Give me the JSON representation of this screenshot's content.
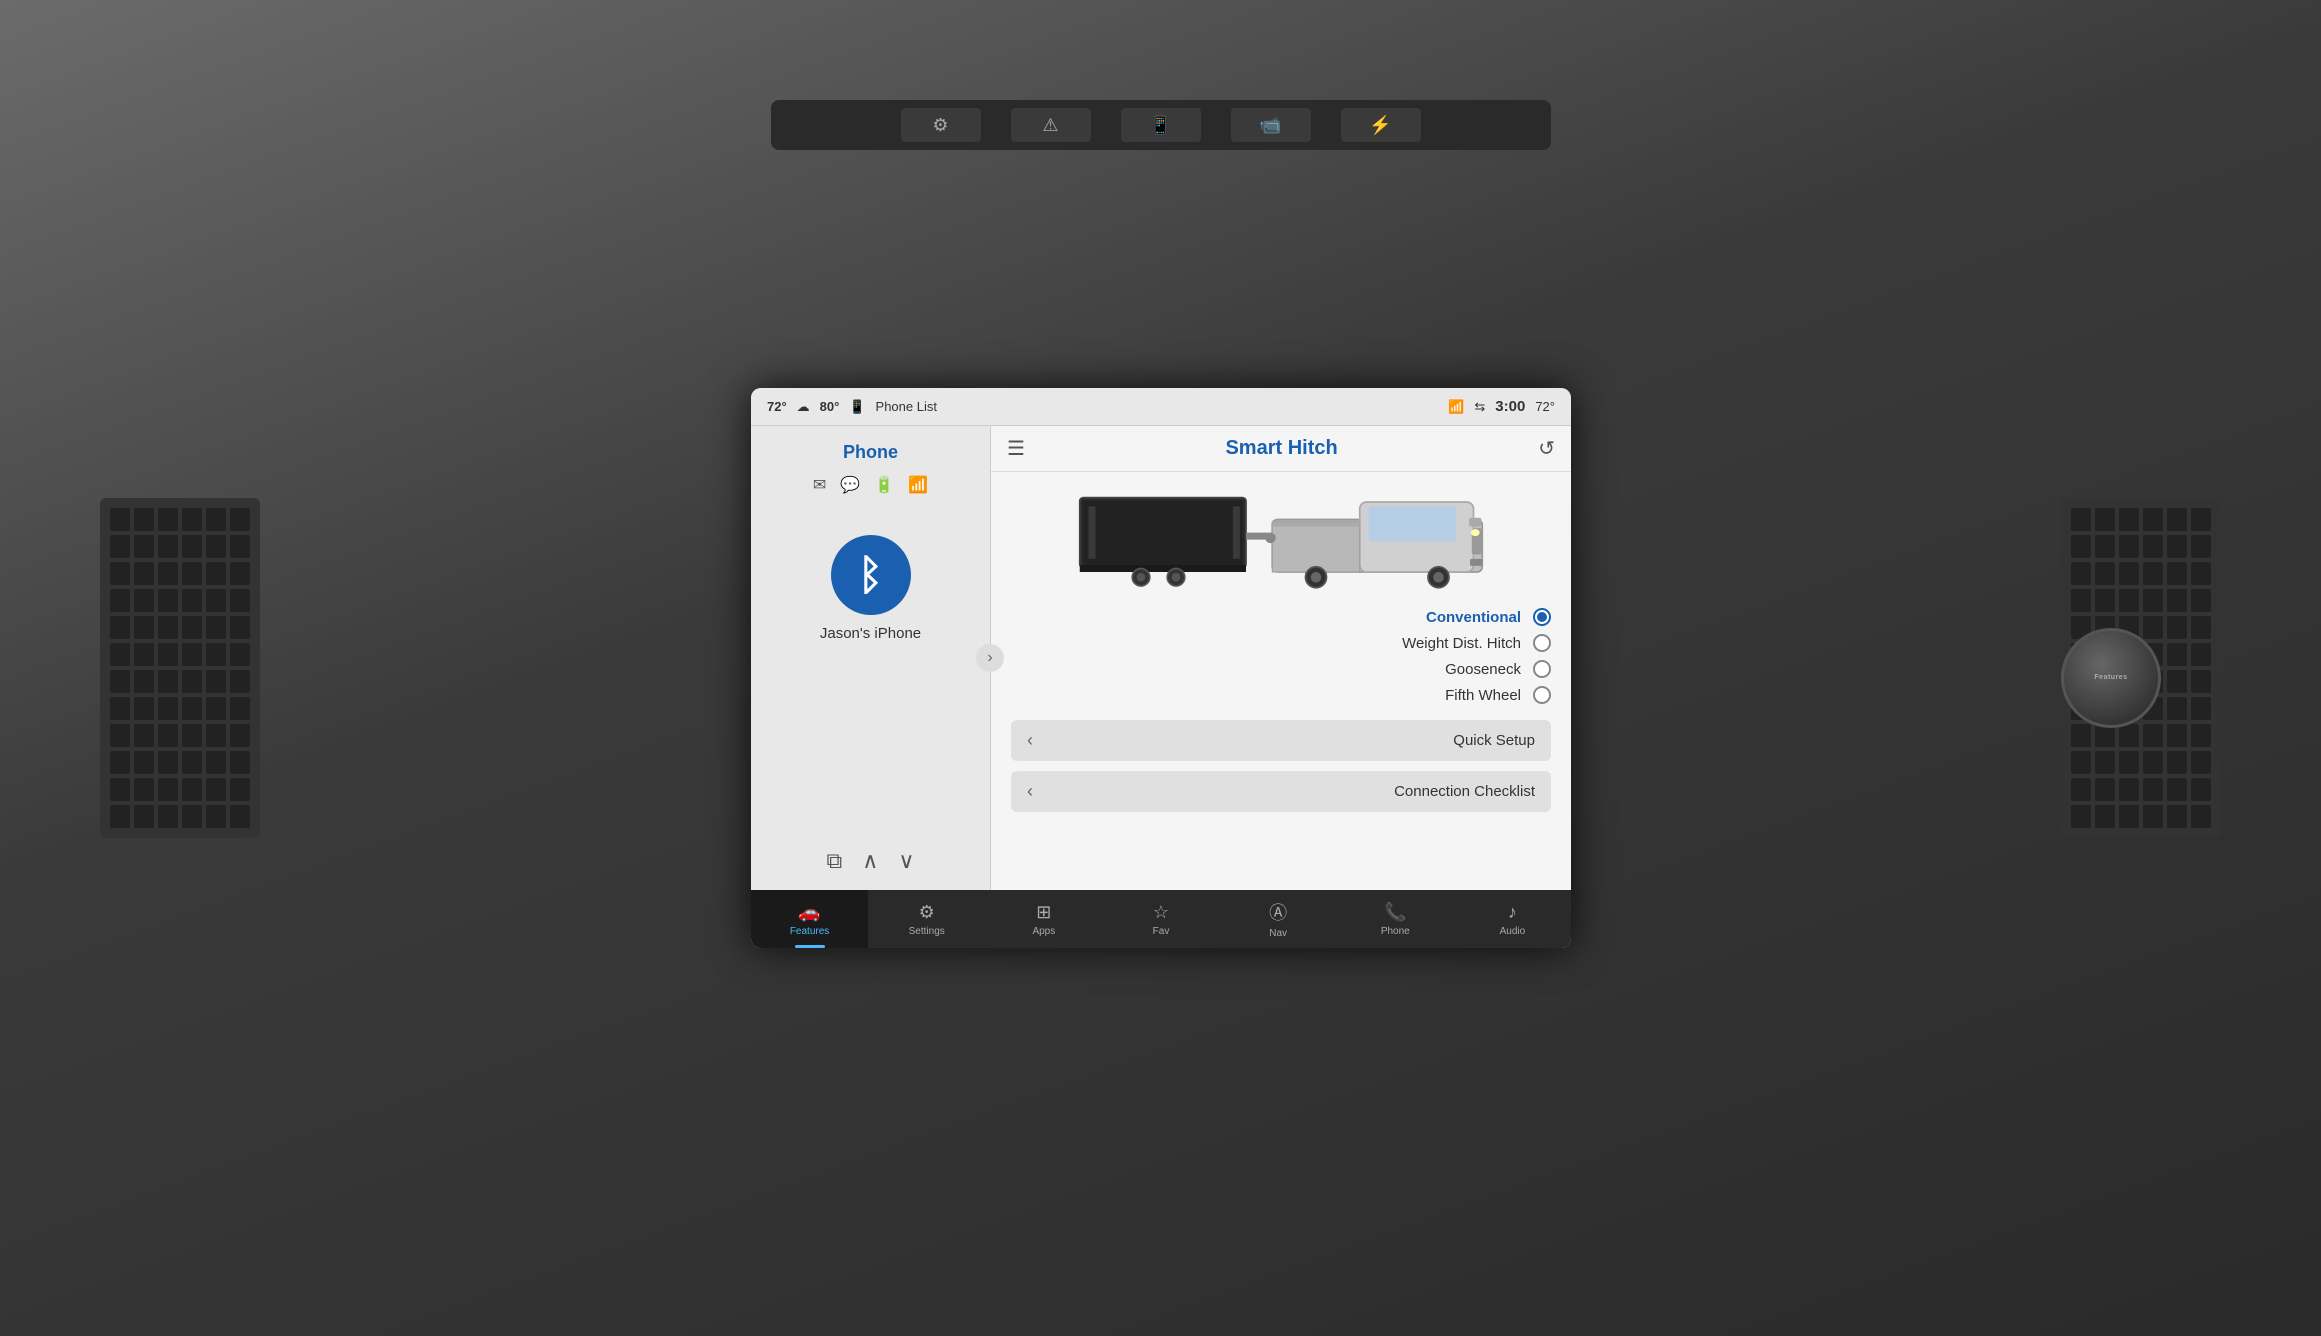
{
  "dashboard": {
    "background": "#4a4a4a"
  },
  "status_bar": {
    "time": "3:00",
    "temp_outside": "72°",
    "temp_inside": "80°",
    "phone_label": "Phone List",
    "wifi_icon": "wifi-icon",
    "bluetooth_icon": "bluetooth-icon",
    "phone_icon": "phone-icon",
    "cloud_icon": "cloud-icon"
  },
  "left_panel": {
    "title": "Phone",
    "device_name": "Jason's iPhone",
    "bluetooth_label": "bluetooth"
  },
  "right_panel": {
    "title": "Smart Hitch",
    "options": [
      {
        "label": "Conventional",
        "selected": true
      },
      {
        "label": "Weight Dist. Hitch",
        "selected": false
      },
      {
        "label": "Gooseneck",
        "selected": false
      },
      {
        "label": "Fifth Wheel",
        "selected": false
      }
    ],
    "action_buttons": [
      {
        "label": "Quick Setup"
      },
      {
        "label": "Connection Checklist"
      }
    ]
  },
  "nav_bar": {
    "items": [
      {
        "label": "Features",
        "icon": "truck-icon",
        "active": true
      },
      {
        "label": "Settings",
        "icon": "settings-icon",
        "active": false
      },
      {
        "label": "Apps",
        "icon": "apps-icon",
        "active": false
      },
      {
        "label": "Fav",
        "icon": "star-icon",
        "active": false
      },
      {
        "label": "Nav",
        "icon": "nav-icon",
        "active": false
      },
      {
        "label": "Phone",
        "icon": "phone-icon",
        "active": false
      },
      {
        "label": "Audio",
        "icon": "audio-icon",
        "active": false
      }
    ]
  },
  "physical_buttons": {
    "buttons": [
      "⚙️",
      "⚠️",
      "📱",
      "📹",
      "🔌"
    ]
  }
}
